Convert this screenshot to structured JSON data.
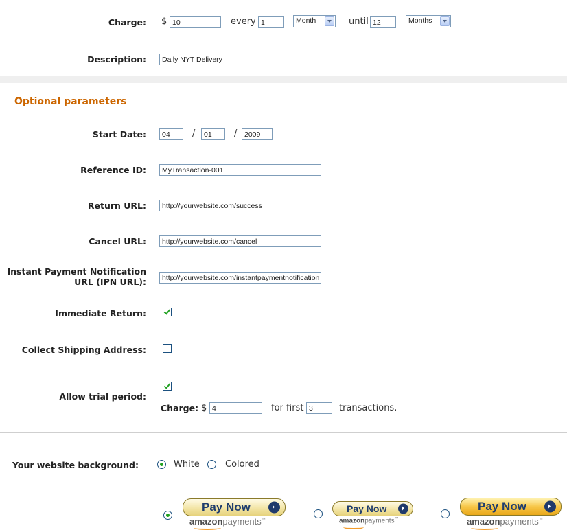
{
  "charge": {
    "label": "Charge:",
    "currency": "$",
    "amount": "10",
    "every_label": "every",
    "every_value": "1",
    "period_unit": "Month",
    "until_label": "until",
    "until_value": "12",
    "until_unit": "Months"
  },
  "description": {
    "label": "Description:",
    "value": "Daily NYT Delivery"
  },
  "optional": {
    "heading": "Optional parameters",
    "start_date": {
      "label": "Start Date:",
      "month": "04",
      "day": "01",
      "year": "2009",
      "separator": "/"
    },
    "reference_id": {
      "label": "Reference ID:",
      "value": "MyTransaction-001"
    },
    "return_url": {
      "label": "Return URL:",
      "value": "http://yourwebsite.com/success"
    },
    "cancel_url": {
      "label": "Cancel URL:",
      "value": "http://yourwebsite.com/cancel"
    },
    "ipn_url": {
      "label_line1": "Instant Payment Notification",
      "label_line2": "URL (IPN URL):",
      "value": "http://yourwebsite.com/instantpaymentnotification"
    },
    "immediate_return": {
      "label": "Immediate Return:",
      "checked": true
    },
    "collect_shipping": {
      "label": "Collect Shipping Address:",
      "checked": false
    },
    "trial": {
      "label": "Allow trial period:",
      "checked": true,
      "charge_label": "Charge:",
      "currency": "$",
      "amount": "4",
      "for_first_label": "for first",
      "count": "3",
      "transactions_label": "transactions."
    }
  },
  "background": {
    "label": "Your website background:",
    "options": [
      "White",
      "Colored"
    ],
    "selected": "White"
  },
  "pay_buttons": [
    {
      "text": "Pay Now",
      "logo_bold": "amazon",
      "logo_light": "payments",
      "tm": "™",
      "style": "cream",
      "selected": true
    },
    {
      "text": "Pay Now",
      "logo_bold": "amazon",
      "logo_light": "payments",
      "tm": "™",
      "style": "cream",
      "selected": false
    },
    {
      "text": "Pay Now",
      "logo_bold": "amazon",
      "logo_light": "payments",
      "tm": "™",
      "style": "gold",
      "selected": false
    }
  ]
}
